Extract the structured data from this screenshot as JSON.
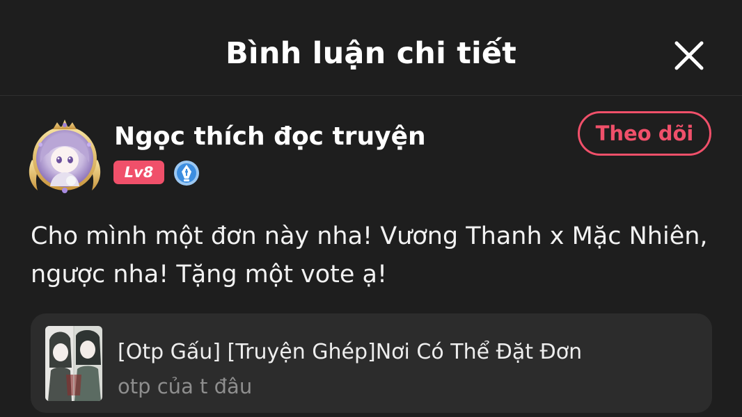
{
  "header": {
    "title": "Bình luận chi tiết",
    "close_icon": "close-icon"
  },
  "author": {
    "name": "Ngọc thích đọc truyện",
    "level": "Lv8",
    "avatar_icon": "avatar-with-crown-frame",
    "badge_icon": "pen-nib-badge-icon",
    "follow_label": "Theo dõi"
  },
  "comment": {
    "line1": "Cho mình một đơn này nha! Vương Thanh x Mặc Nhiên,",
    "line2": "ngược nha! Tặng một vote ạ!"
  },
  "story": {
    "title": "[Otp Gấu] [Truyện Ghép]Nơi Có Thể Đặt Đơn",
    "subtitle": "otp của t đâu"
  },
  "colors": {
    "background": "#1e1e1e",
    "accent": "#f0506a",
    "card": "#2c2c2c",
    "muted_text": "#8e8e8e",
    "badge_blue": "#3d8ee0"
  }
}
